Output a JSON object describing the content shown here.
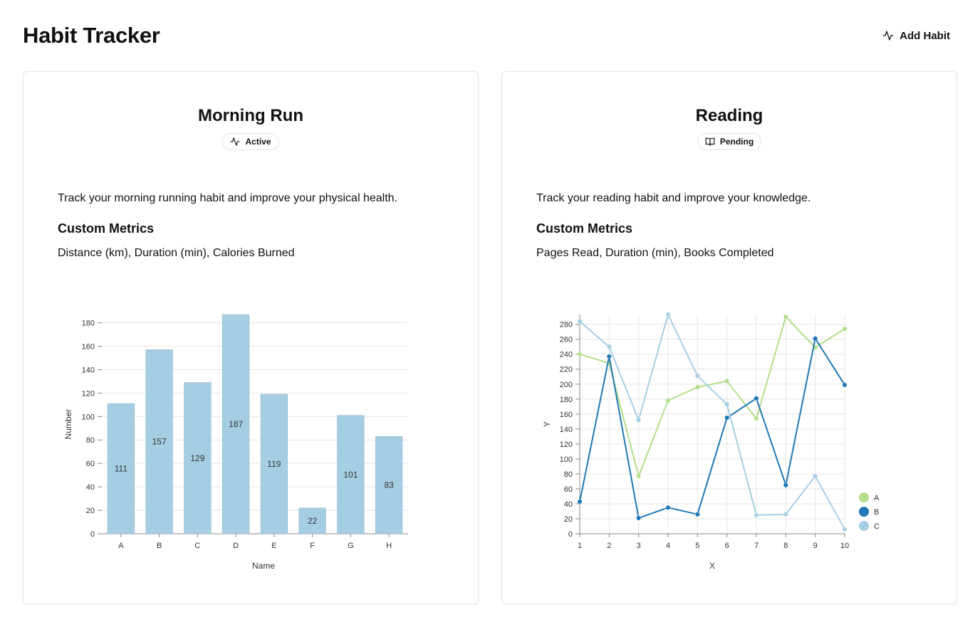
{
  "app": {
    "title": "Habit Tracker",
    "add_button": "Add Habit",
    "add_icon": "activity-icon"
  },
  "habits": [
    {
      "title": "Morning Run",
      "status": "Active",
      "status_icon": "activity-icon",
      "description": "Track your morning running habit and improve your physical health.",
      "metrics_heading": "Custom Metrics",
      "metrics": "Distance (km), Duration (min), Calories Burned"
    },
    {
      "title": "Reading",
      "status": "Pending",
      "status_icon": "book-open-icon",
      "description": "Track your reading habit and improve your knowledge.",
      "metrics_heading": "Custom Metrics",
      "metrics": "Pages Read, Duration (min), Books Completed"
    }
  ],
  "chart_data": [
    {
      "type": "bar",
      "categories": [
        "A",
        "B",
        "C",
        "D",
        "E",
        "F",
        "G",
        "H"
      ],
      "values": [
        111,
        157,
        129,
        187,
        119,
        22,
        101,
        83
      ],
      "xlabel": "Name",
      "ylabel": "Number",
      "ylim": [
        0,
        187
      ],
      "yticks": [
        0,
        20,
        40,
        60,
        80,
        100,
        120,
        140,
        160,
        180
      ],
      "grid": "horizontal",
      "color": "#a6cee3",
      "data_labels": true
    },
    {
      "type": "line",
      "x": [
        1,
        2,
        3,
        4,
        5,
        6,
        7,
        8,
        9,
        10
      ],
      "series": [
        {
          "name": "A",
          "color": "#b2df8a",
          "values": [
            240,
            228,
            77,
            178,
            196,
            204,
            154,
            290,
            249,
            274
          ]
        },
        {
          "name": "B",
          "color": "#1f78b4",
          "values": [
            43,
            237,
            21,
            35,
            26,
            155,
            181,
            65,
            261,
            199
          ]
        },
        {
          "name": "C",
          "color": "#a6cee3",
          "values": [
            284,
            250,
            152,
            293,
            211,
            173,
            25,
            26,
            77,
            6
          ]
        }
      ],
      "xlabel": "X",
      "ylabel": "Y",
      "xlim": [
        1,
        10
      ],
      "ylim": [
        0,
        293
      ],
      "yticks": [
        0,
        20,
        40,
        60,
        80,
        100,
        120,
        140,
        160,
        180,
        200,
        220,
        240,
        260,
        280
      ],
      "grid": "both",
      "legend": "right"
    }
  ]
}
